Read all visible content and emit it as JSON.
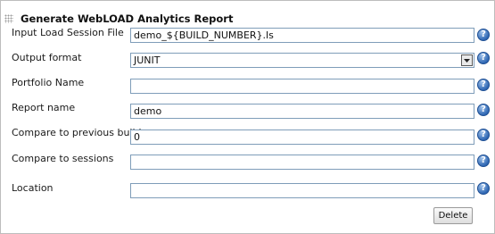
{
  "header": {
    "title": "Generate WebLOAD Analytics Report"
  },
  "form": {
    "input_session": {
      "label": "Input Load Session File",
      "value": "demo_${BUILD_NUMBER}.ls"
    },
    "output_format": {
      "label": "Output format",
      "selected": "JUNIT"
    },
    "portfolio_name": {
      "label": "Portfolio Name",
      "value": ""
    },
    "report_name": {
      "label": "Report name",
      "value": "demo"
    },
    "compare_previous": {
      "label": "Compare to previous builds",
      "value": "0"
    },
    "compare_sessions": {
      "label": "Compare to sessions",
      "value": ""
    },
    "location": {
      "label": "Location",
      "value": ""
    }
  },
  "help": {
    "glyph": "?"
  },
  "actions": {
    "delete_label": "Delete"
  },
  "icons": {
    "help": "help-icon",
    "drag": "drag-handle-icon",
    "dropdown": "chevron-down-icon"
  }
}
